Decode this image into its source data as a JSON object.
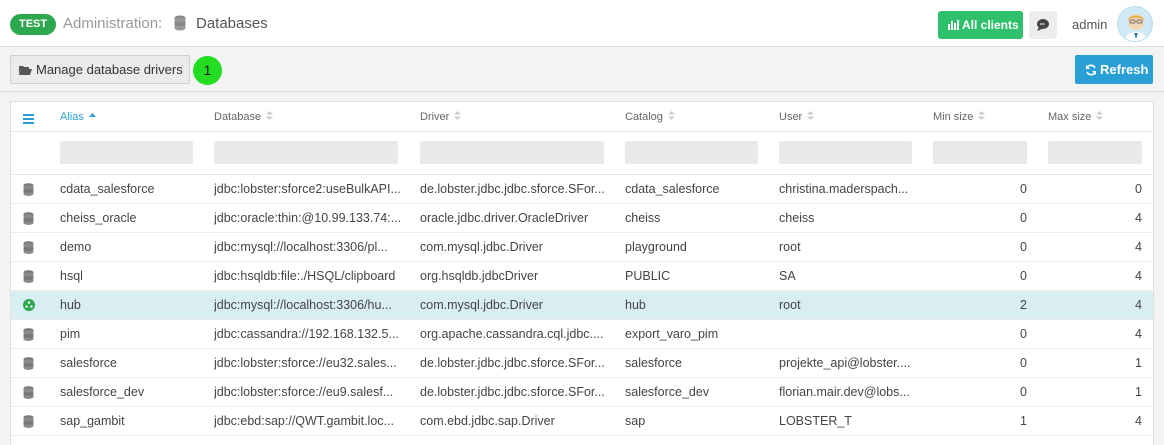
{
  "header": {
    "env_badge": "TEST",
    "breadcrumb_parent": "Administration:",
    "breadcrumb_current": "Databases",
    "all_clients_label": "All clients",
    "username": "admin"
  },
  "toolbar": {
    "manage_drivers_label": "Manage database drivers",
    "count_badge": "1",
    "refresh_label": "Refresh"
  },
  "table": {
    "columns": [
      {
        "label": "Alias",
        "sorted": "asc"
      },
      {
        "label": "Database"
      },
      {
        "label": "Driver"
      },
      {
        "label": "Catalog"
      },
      {
        "label": "User"
      },
      {
        "label": "Min size"
      },
      {
        "label": "Max size"
      }
    ],
    "rows": [
      {
        "alias": "cdata_salesforce",
        "database": "jdbc:lobster:sforce2:useBulkAPI...",
        "driver": "de.lobster.jdbc.jdbc.sforce.SFor...",
        "catalog": "cdata_salesforce",
        "user": "christina.maderspach...",
        "min": "0",
        "max": "0",
        "status": "database"
      },
      {
        "alias": "cheiss_oracle",
        "database": "jdbc:oracle:thin:@10.99.133.74:...",
        "driver": "oracle.jdbc.driver.OracleDriver",
        "catalog": "cheiss",
        "user": "cheiss",
        "min": "0",
        "max": "4",
        "status": "database"
      },
      {
        "alias": "demo",
        "database": "jdbc:mysql://localhost:3306/pl...",
        "driver": "com.mysql.jdbc.Driver",
        "catalog": "playground",
        "user": "root",
        "min": "0",
        "max": "4",
        "status": "database"
      },
      {
        "alias": "hsql",
        "database": "jdbc:hsqldb:file:./HSQL/clipboard",
        "driver": "org.hsqldb.jdbcDriver",
        "catalog": "PUBLIC",
        "user": "SA",
        "min": "0",
        "max": "4",
        "status": "database"
      },
      {
        "alias": "hub",
        "database": "jdbc:mysql://localhost:3306/hu...",
        "driver": "com.mysql.jdbc.Driver",
        "catalog": "hub",
        "user": "root",
        "min": "2",
        "max": "4",
        "status": "active"
      },
      {
        "alias": "pim",
        "database": "jdbc:cassandra://192.168.132.5...",
        "driver": "org.apache.cassandra.cql.jdbc....",
        "catalog": "export_varo_pim",
        "user": "",
        "min": "0",
        "max": "4",
        "status": "database"
      },
      {
        "alias": "salesforce",
        "database": "jdbc:lobster:sforce://eu32.sales...",
        "driver": "de.lobster.jdbc.jdbc.sforce.SFor...",
        "catalog": "salesforce",
        "user": "projekte_api@lobster....",
        "min": "0",
        "max": "1",
        "status": "database"
      },
      {
        "alias": "salesforce_dev",
        "database": "jdbc:lobster:sforce://eu9.salesf...",
        "driver": "de.lobster.jdbc.jdbc.sforce.SFor...",
        "catalog": "salesforce_dev",
        "user": "florian.mair.dev@lobs...",
        "min": "0",
        "max": "1",
        "status": "database"
      },
      {
        "alias": "sap_gambit",
        "database": "jdbc:ebd:sap://QWT.gambit.loc...",
        "driver": "com.ebd.jdbc.sap.Driver",
        "catalog": "sap",
        "user": "LOBSTER_T",
        "min": "1",
        "max": "4",
        "status": "database"
      }
    ],
    "selected_row": 4
  },
  "colors": {
    "accent": "#2a9fd6",
    "green": "#2ec06b",
    "selected_row": "#d8eef3",
    "active_status": "#2ea84f"
  }
}
